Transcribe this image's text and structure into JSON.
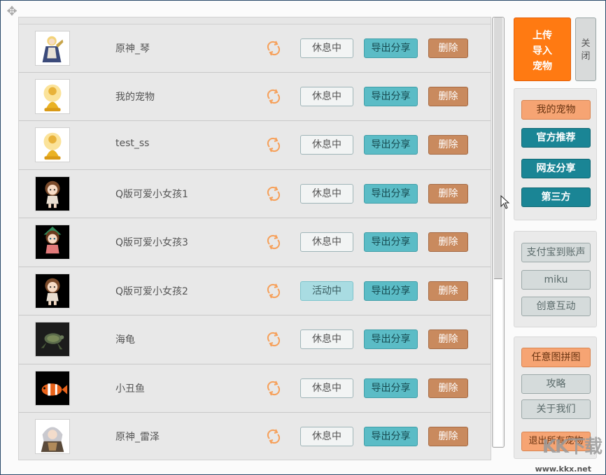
{
  "pets": [
    {
      "name": "原神_琴",
      "status": "休息中",
      "active": false,
      "thumb": "blonde-knight"
    },
    {
      "name": "我的宠物",
      "status": "休息中",
      "active": false,
      "thumb": "golden-buddha"
    },
    {
      "name": "test_ss",
      "status": "休息中",
      "active": false,
      "thumb": "golden-buddha"
    },
    {
      "name": "Q版可爱小女孩1",
      "status": "休息中",
      "active": false,
      "thumb": "chibi-girl"
    },
    {
      "name": "Q版可爱小女孩3",
      "status": "休息中",
      "active": false,
      "thumb": "chibi-girl-green"
    },
    {
      "name": "Q版可爱小女孩2",
      "status": "活动中",
      "active": true,
      "thumb": "chibi-girl"
    },
    {
      "name": "海龟",
      "status": "休息中",
      "active": false,
      "thumb": "sea-turtle"
    },
    {
      "name": "小丑鱼",
      "status": "休息中",
      "active": false,
      "thumb": "clownfish"
    },
    {
      "name": "原神_雷泽",
      "status": "休息中",
      "active": false,
      "thumb": "white-hair-boy"
    }
  ],
  "row_buttons": {
    "export": "导出分享",
    "delete": "删除"
  },
  "upload": {
    "line1": "上传",
    "line2": "导入",
    "line3": "宠物"
  },
  "close": {
    "line1": "关",
    "line2": "闭"
  },
  "group1": [
    "我的宠物",
    "官方推荐",
    "网友分享",
    "第三方"
  ],
  "group2": [
    "支付宝到账声",
    "miku",
    "创意互动"
  ],
  "group3": [
    "任意图拼图",
    "攻略",
    "关于我们",
    "退出所有宠物"
  ],
  "watermark": {
    "big": "KK下载",
    "small": "www.kkx.net"
  },
  "colors": {
    "accent_orange": "#ff7a12",
    "teal": "#1a8595",
    "export": "#5bbcc6",
    "delete": "#c98a5e",
    "active_status": "#a9dce2"
  },
  "icons": {
    "move": "move-icon",
    "refresh": "refresh-icon",
    "cursor": "mouse-cursor-icon"
  }
}
